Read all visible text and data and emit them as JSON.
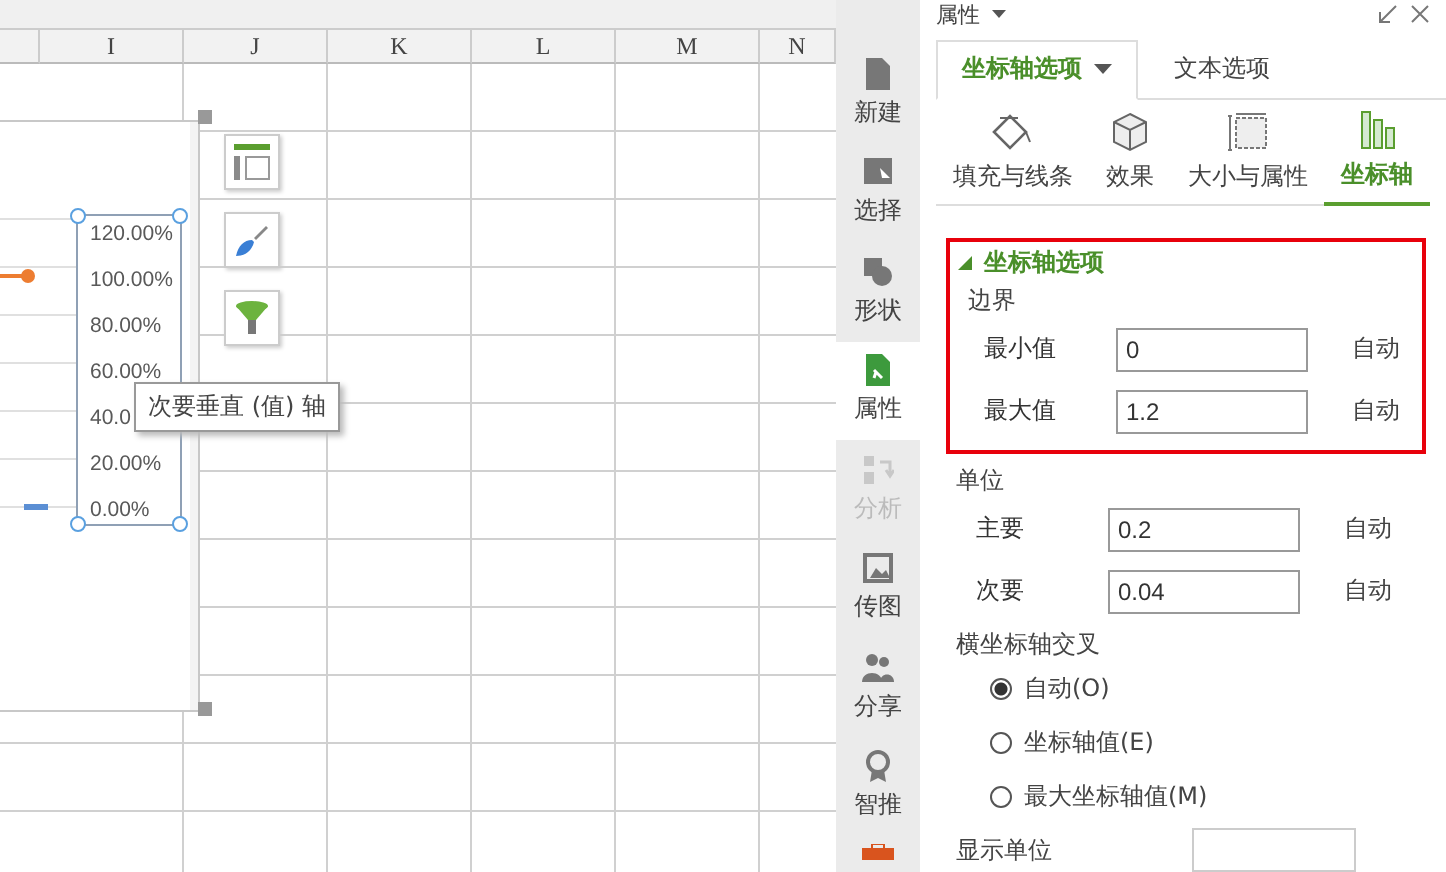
{
  "spreadsheet": {
    "column_headers": [
      "I",
      "J",
      "K",
      "L",
      "M",
      "N"
    ]
  },
  "chart": {
    "axis_labels": [
      "120.00%",
      "100.00%",
      "80.00%",
      "60.00%",
      "40.0",
      "20.00%",
      "0.00%"
    ],
    "axis_selected": true,
    "tooltip": "次要垂直 (值) 轴"
  },
  "chart_tools": [
    {
      "kind": "elements"
    },
    {
      "kind": "style"
    },
    {
      "kind": "filter"
    }
  ],
  "sidebar": {
    "items": [
      {
        "label": "新建",
        "kind": "new",
        "selected": false,
        "disabled": false
      },
      {
        "label": "选择",
        "kind": "select",
        "selected": false,
        "disabled": false
      },
      {
        "label": "形状",
        "kind": "shape",
        "selected": false,
        "disabled": false
      },
      {
        "label": "属性",
        "kind": "properties",
        "selected": true,
        "disabled": false
      },
      {
        "label": "分析",
        "kind": "analyze",
        "selected": false,
        "disabled": true
      },
      {
        "label": "传图",
        "kind": "image",
        "selected": false,
        "disabled": false
      },
      {
        "label": "分享",
        "kind": "share",
        "selected": false,
        "disabled": false
      },
      {
        "label": "智推",
        "kind": "recommend",
        "selected": false,
        "disabled": false
      }
    ]
  },
  "panel": {
    "title": "属性",
    "tabs": [
      {
        "label": "坐标轴选项",
        "selected": true,
        "dropdown": true
      },
      {
        "label": "文本选项",
        "selected": false,
        "dropdown": false
      }
    ],
    "icon_tabs": [
      {
        "label": "填充与线条",
        "kind": "fill",
        "selected": false
      },
      {
        "label": "效果",
        "kind": "effect",
        "selected": false
      },
      {
        "label": "大小与属性",
        "kind": "size",
        "selected": false
      },
      {
        "label": "坐标轴",
        "kind": "axis",
        "selected": true
      }
    ],
    "section": {
      "title": "坐标轴选项",
      "expanded": true,
      "highlighted": true
    },
    "groups": [
      {
        "title": "边界",
        "fields": [
          {
            "label": "最小值",
            "value": "0",
            "button": "自动"
          },
          {
            "label": "最大值",
            "value": "1.2",
            "button": "自动"
          }
        ]
      },
      {
        "title": "单位",
        "fields": [
          {
            "label": "主要",
            "value": "0.2",
            "button": "自动"
          },
          {
            "label": "次要",
            "value": "0.04",
            "button": "自动"
          }
        ]
      }
    ],
    "crosses": {
      "title": "横坐标轴交叉",
      "options": [
        {
          "label": "自动(O)",
          "selected": true
        },
        {
          "label": "坐标轴值(E)",
          "selected": false
        },
        {
          "label": "最大坐标轴值(M)",
          "selected": false
        }
      ]
    },
    "display_units": {
      "label": "显示单位"
    }
  }
}
